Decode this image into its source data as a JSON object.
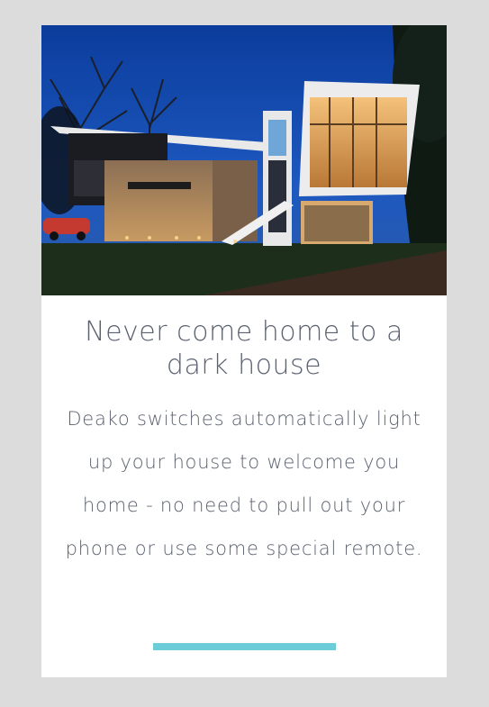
{
  "card": {
    "image_alt": "Modern house lit up at dusk",
    "title": "Never come home to a dark house",
    "body": "Deako switches automatically light up your house to welcome you home - no need to pull out your phone or use some special remote."
  },
  "colors": {
    "page_background": "#dcdcdc",
    "card_background": "#ffffff",
    "text": "#5a6170",
    "accent": "#6ccdd8"
  }
}
